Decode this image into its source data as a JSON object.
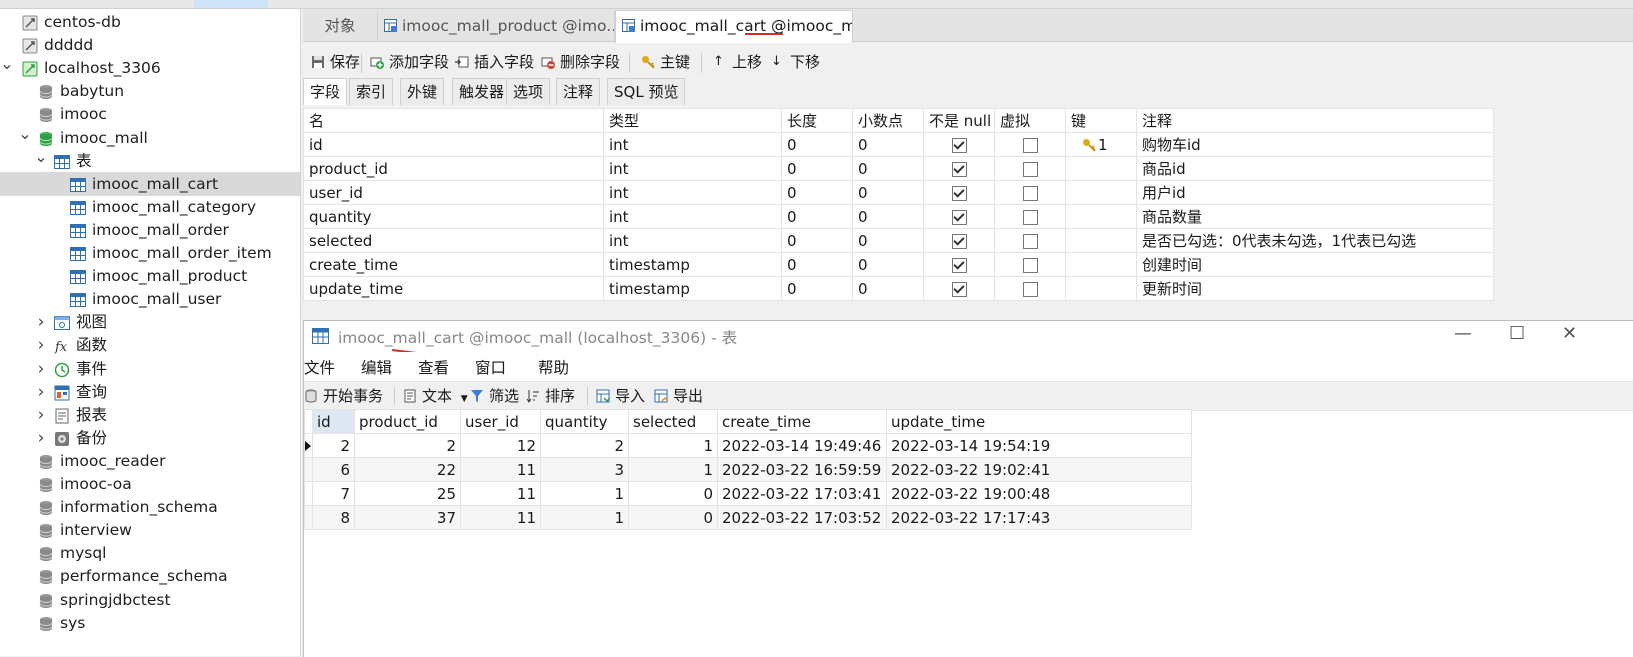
{
  "sidebar": {
    "items": [
      {
        "label": "centos-db",
        "level": 0,
        "icon": "connection-icon",
        "arrow": ""
      },
      {
        "label": "ddddd",
        "level": 0,
        "icon": "connection-icon",
        "arrow": ""
      },
      {
        "label": "localhost_3306",
        "level": 0,
        "icon": "connection-active-icon",
        "arrow": "v"
      },
      {
        "label": "babytun",
        "level": 1,
        "icon": "database-icon",
        "arrow": ""
      },
      {
        "label": "imooc",
        "level": 1,
        "icon": "database-icon",
        "arrow": ""
      },
      {
        "label": "imooc_mall",
        "level": 1,
        "icon": "database-open-icon",
        "arrow": "v"
      },
      {
        "label": "表",
        "level": 2,
        "icon": "tables-folder-icon",
        "arrow": "v"
      },
      {
        "label": "imooc_mall_cart",
        "level": 3,
        "icon": "table-icon",
        "arrow": "",
        "selected": true
      },
      {
        "label": "imooc_mall_category",
        "level": 3,
        "icon": "table-icon",
        "arrow": ""
      },
      {
        "label": "imooc_mall_order",
        "level": 3,
        "icon": "table-icon",
        "arrow": ""
      },
      {
        "label": "imooc_mall_order_item",
        "level": 3,
        "icon": "table-icon",
        "arrow": ""
      },
      {
        "label": "imooc_mall_product",
        "level": 3,
        "icon": "table-icon",
        "arrow": ""
      },
      {
        "label": "imooc_mall_user",
        "level": 3,
        "icon": "table-icon",
        "arrow": ""
      },
      {
        "label": "视图",
        "level": 2,
        "icon": "view-icon",
        "arrow": ">"
      },
      {
        "label": "函数",
        "level": 2,
        "icon": "function-icon",
        "arrow": ">"
      },
      {
        "label": "事件",
        "level": 2,
        "icon": "event-icon",
        "arrow": ">"
      },
      {
        "label": "查询",
        "level": 2,
        "icon": "query-icon",
        "arrow": ">"
      },
      {
        "label": "报表",
        "level": 2,
        "icon": "report-icon",
        "arrow": ">"
      },
      {
        "label": "备份",
        "level": 2,
        "icon": "backup-icon",
        "arrow": ">"
      },
      {
        "label": "imooc_reader",
        "level": 1,
        "icon": "database-icon",
        "arrow": ""
      },
      {
        "label": "imooc-oa",
        "level": 1,
        "icon": "database-icon",
        "arrow": ""
      },
      {
        "label": "information_schema",
        "level": 1,
        "icon": "database-icon",
        "arrow": ""
      },
      {
        "label": "interview",
        "level": 1,
        "icon": "database-icon",
        "arrow": ""
      },
      {
        "label": "mysql",
        "level": 1,
        "icon": "database-icon",
        "arrow": ""
      },
      {
        "label": "performance_schema",
        "level": 1,
        "icon": "database-icon",
        "arrow": ""
      },
      {
        "label": "springjdbctest",
        "level": 1,
        "icon": "database-icon",
        "arrow": ""
      },
      {
        "label": "sys",
        "level": 1,
        "icon": "database-icon",
        "arrow": ""
      }
    ]
  },
  "tabs": {
    "objects": "对象",
    "product": "imooc_mall_product @imo...",
    "cart": "imooc_mall_cart @imooc_m..."
  },
  "toolbar": {
    "save": "保存",
    "add_field": "添加字段",
    "insert_field": "插入字段",
    "delete_field": "删除字段",
    "primary_key": "主键",
    "move_up": "上移",
    "move_down": "下移"
  },
  "subtabs": [
    "字段",
    "索引",
    "外键",
    "触发器",
    "选项",
    "注释",
    "SQL 预览"
  ],
  "fields": {
    "headers": [
      "名",
      "类型",
      "长度",
      "小数点",
      "不是 null",
      "虚拟",
      "键",
      "注释"
    ],
    "rows": [
      {
        "name": "id",
        "type": "int",
        "length": "0",
        "decimals": "0",
        "not_null": true,
        "virtual": false,
        "key": "1",
        "comment": "购物车id"
      },
      {
        "name": "product_id",
        "type": "int",
        "length": "0",
        "decimals": "0",
        "not_null": true,
        "virtual": false,
        "key": "",
        "comment": "商品id"
      },
      {
        "name": "user_id",
        "type": "int",
        "length": "0",
        "decimals": "0",
        "not_null": true,
        "virtual": false,
        "key": "",
        "comment": "用户id"
      },
      {
        "name": "quantity",
        "type": "int",
        "length": "0",
        "decimals": "0",
        "not_null": true,
        "virtual": false,
        "key": "",
        "comment": "商品数量"
      },
      {
        "name": "selected",
        "type": "int",
        "length": "0",
        "decimals": "0",
        "not_null": true,
        "virtual": false,
        "key": "",
        "comment": "是否已勾选：0代表未勾选，1代表已勾选"
      },
      {
        "name": "create_time",
        "type": "timestamp",
        "length": "0",
        "decimals": "0",
        "not_null": true,
        "virtual": false,
        "key": "",
        "comment": "创建时间"
      },
      {
        "name": "update_time",
        "type": "timestamp",
        "length": "0",
        "decimals": "0",
        "not_null": true,
        "virtual": false,
        "key": "",
        "comment": "更新时间"
      }
    ]
  },
  "data_window": {
    "title": "imooc_mall_cart @imooc_mall (localhost_3306) - 表",
    "menus": [
      "文件",
      "编辑",
      "查看",
      "窗口",
      "帮助"
    ],
    "toolbar": {
      "begin_tx": "开始事务",
      "text": "文本",
      "filter": "筛选",
      "sort": "排序",
      "import": "导入",
      "export": "导出"
    },
    "columns": [
      "id",
      "product_id",
      "user_id",
      "quantity",
      "selected",
      "create_time",
      "update_time"
    ],
    "rows": [
      [
        "2",
        "2",
        "12",
        "2",
        "1",
        "2022-03-14 19:49:46",
        "2022-03-14 19:54:19"
      ],
      [
        "6",
        "22",
        "11",
        "3",
        "1",
        "2022-03-22 16:59:59",
        "2022-03-22 19:02:41"
      ],
      [
        "7",
        "25",
        "11",
        "1",
        "0",
        "2022-03-22 17:03:41",
        "2022-03-22 19:00:48"
      ],
      [
        "8",
        "37",
        "11",
        "1",
        "0",
        "2022-03-22 17:03:52",
        "2022-03-22 17:17:43"
      ]
    ]
  },
  "colors": {
    "annotation_red": "#d42b2b",
    "table_icon_blue": "#2f6fb3",
    "db_icon_gray": "#8a8a8a",
    "key_gold": "#d9a21b"
  }
}
